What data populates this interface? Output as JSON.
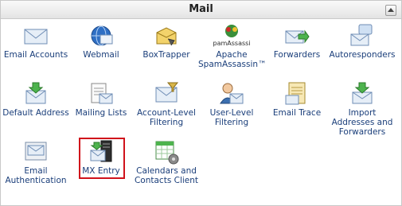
{
  "panel": {
    "title": "Mail"
  },
  "items": [
    {
      "label": "Email Accounts",
      "icon": "email-accounts-icon"
    },
    {
      "label": "Webmail",
      "icon": "webmail-icon"
    },
    {
      "label": "BoxTrapper",
      "icon": "boxtrapper-icon"
    },
    {
      "label": "Apache SpamAssassin™",
      "icon": "spamassassin-icon",
      "logo_text": "SpamAssassin"
    },
    {
      "label": "Forwarders",
      "icon": "forwarders-icon"
    },
    {
      "label": "Autoresponders",
      "icon": "autoresponders-icon"
    },
    {
      "label": "Default Address",
      "icon": "default-address-icon"
    },
    {
      "label": "Mailing Lists",
      "icon": "mailing-lists-icon"
    },
    {
      "label": "Account-Level Filtering",
      "icon": "account-filtering-icon"
    },
    {
      "label": "User-Level Filtering",
      "icon": "user-filtering-icon"
    },
    {
      "label": "Email Trace",
      "icon": "email-trace-icon"
    },
    {
      "label": "Import Addresses and Forwarders",
      "icon": "import-addresses-icon"
    },
    {
      "label": "Email Authentication",
      "icon": "email-authentication-icon"
    },
    {
      "label": "MX Entry",
      "icon": "mx-entry-icon",
      "highlighted": true
    },
    {
      "label": "Calendars and Contacts Client",
      "icon": "calendars-contacts-icon"
    }
  ],
  "colors": {
    "link": "#1a3e7a",
    "highlight": "#d0121b"
  }
}
